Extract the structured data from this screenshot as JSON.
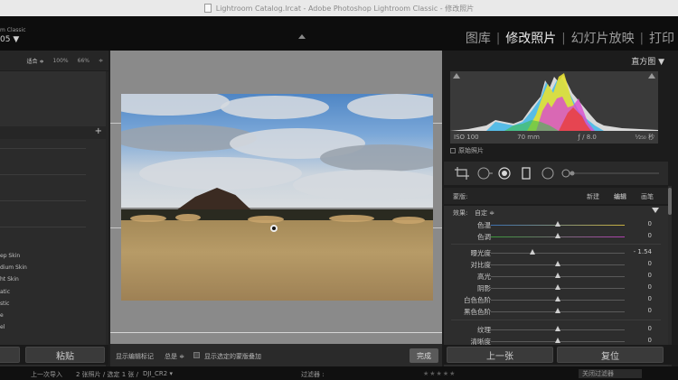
{
  "window": {
    "title": "Lightroom Catalog.lrcat - Adobe Photoshop Lightroom Classic - 修改照片"
  },
  "identity": {
    "brand_line": "m Classic",
    "version": "05 ▼",
    "modules": [
      "图库",
      "修改照片",
      "幻灯片放映",
      "打印"
    ],
    "active_module": "修改照片"
  },
  "navigator": {
    "fit": "适合 ≑",
    "zoom1": "100%",
    "zoom2": "66%",
    "zoom_arrow": "≑"
  },
  "presets": {
    "add": "+",
    "items": [
      "ep Skin",
      "dium Skin",
      "ht Skin",
      "atic",
      "stic",
      "e",
      "el"
    ]
  },
  "left_buttons": {
    "paste": "粘贴"
  },
  "toolbar": {
    "show_edit_pins": "显示编辑标记",
    "always": "总是 ≑",
    "show_overlay": "显示选定的蒙版叠加",
    "done": "完成"
  },
  "histogram": {
    "title": "直方图 ▼",
    "iso": "ISO 100",
    "focal": "70 mm",
    "aperture": "ƒ / 8.0",
    "shutter": "¹⁄₂₅₀ 秒",
    "original_photo": "原始照片"
  },
  "mask": {
    "label": "蒙版:",
    "new": "新建",
    "edit": "编辑",
    "brush": "画笔"
  },
  "effects": {
    "label": "效果:",
    "preset": "自定 ≑",
    "sliders": [
      {
        "name": "色温",
        "value": "0",
        "pos": 0.5
      },
      {
        "name": "色调",
        "value": "0",
        "pos": 0.5
      },
      {
        "name": "曝光度",
        "value": "- 1.54",
        "pos": 0.31
      },
      {
        "name": "对比度",
        "value": "0",
        "pos": 0.5
      },
      {
        "name": "高光",
        "value": "0",
        "pos": 0.5
      },
      {
        "name": "阴影",
        "value": "0",
        "pos": 0.5
      },
      {
        "name": "白色色阶",
        "value": "0",
        "pos": 0.5
      },
      {
        "name": "黑色色阶",
        "value": "0",
        "pos": 0.5
      },
      {
        "name": "纹理",
        "value": "0",
        "pos": 0.5
      },
      {
        "name": "清晰度",
        "value": "0",
        "pos": 0.5
      }
    ]
  },
  "right_buttons": {
    "previous": "上一张",
    "reset": "复位"
  },
  "filmstrip": {
    "prev_import": "上一次导入",
    "count": "2 张照片 / 选定 1 张 /",
    "file": "DJI_CR2 ▾",
    "filter_label": "过滤器 :",
    "filter_value": "关闭过滤器"
  }
}
